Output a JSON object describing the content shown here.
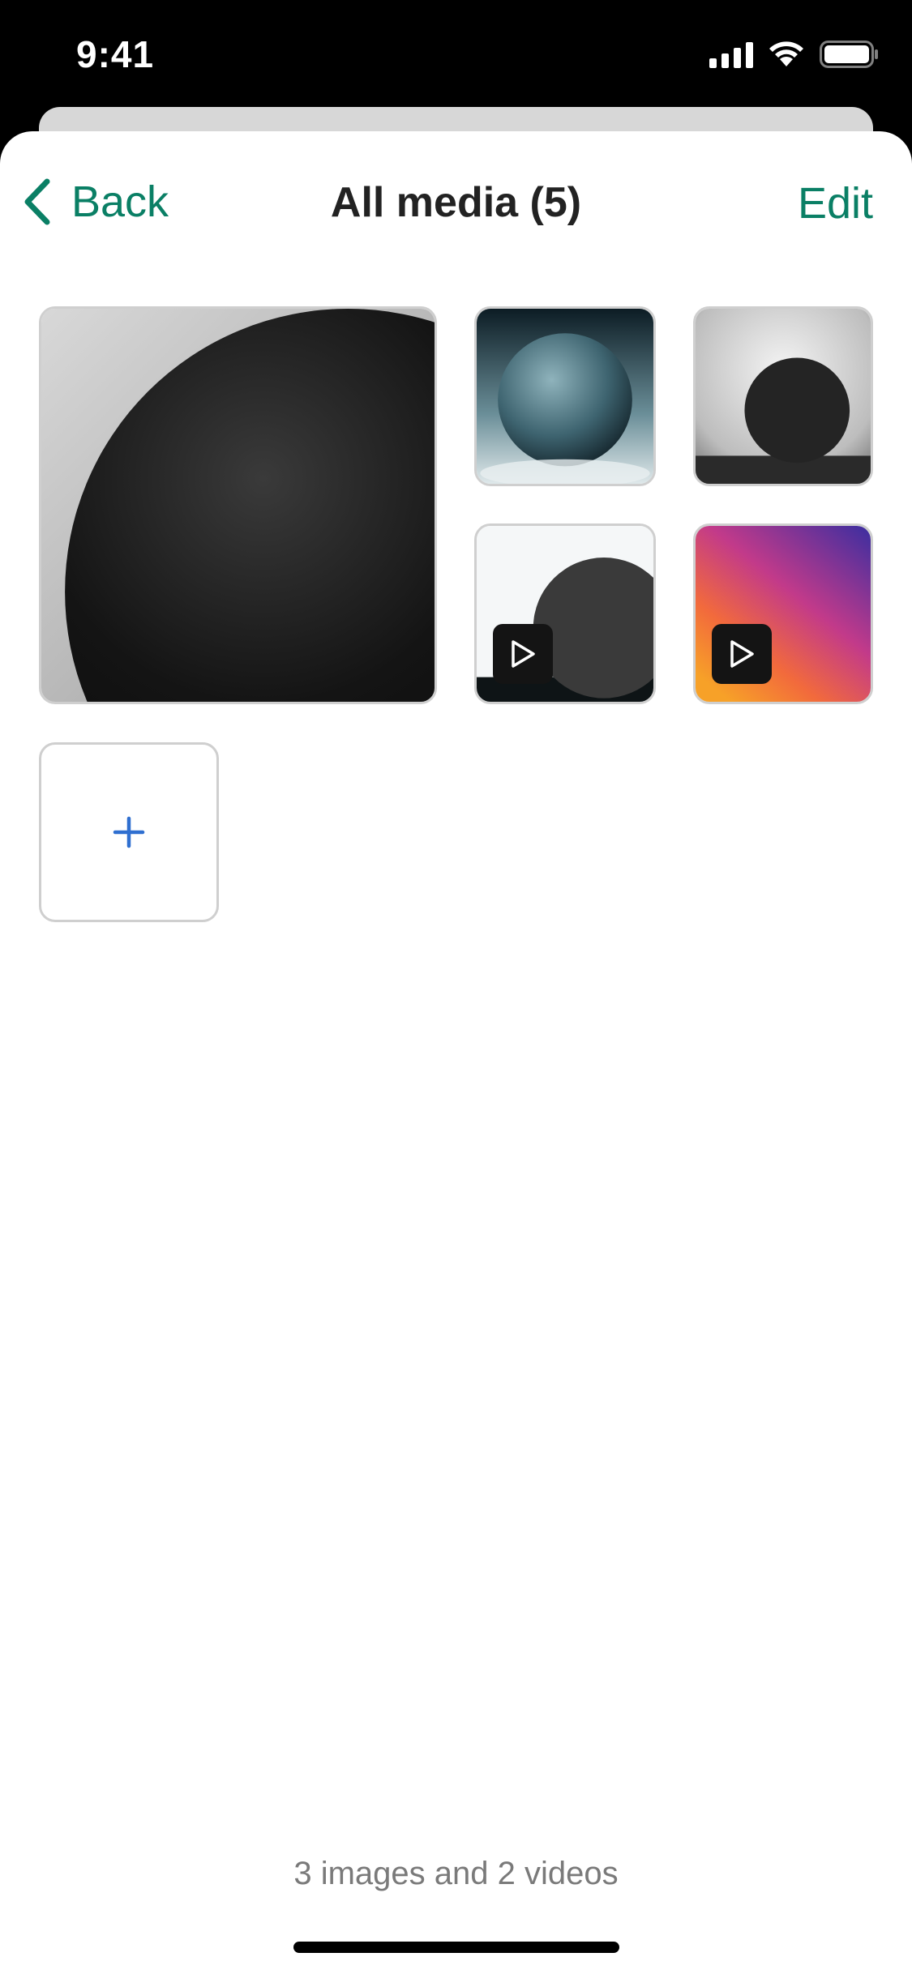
{
  "status_bar": {
    "time": "9:41"
  },
  "nav": {
    "back_label": "Back",
    "title": "All media (5)",
    "edit_label": "Edit"
  },
  "media": [
    {
      "kind": "image"
    },
    {
      "kind": "image"
    },
    {
      "kind": "image"
    },
    {
      "kind": "video"
    },
    {
      "kind": "video"
    }
  ],
  "summary": "3 images and 2 videos",
  "colors": {
    "accent": "#0a7f65",
    "add_icon": "#2f6fd0"
  }
}
